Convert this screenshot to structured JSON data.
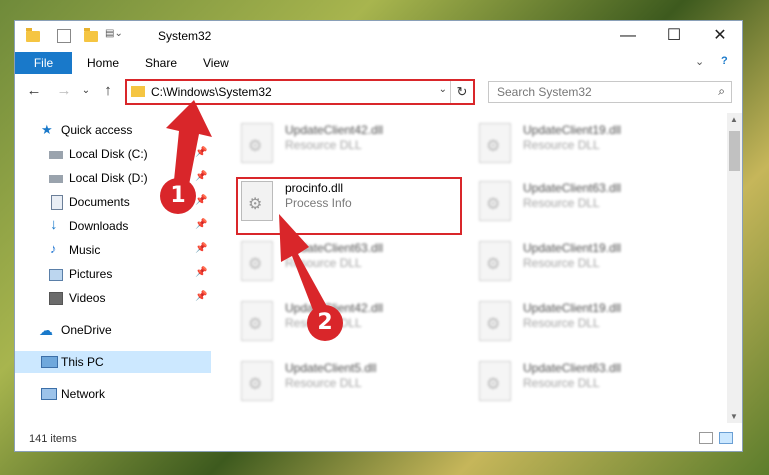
{
  "window": {
    "title": "System32",
    "minimize": "—",
    "maximize": "☐",
    "close": "✕"
  },
  "ribbon": {
    "tabs": [
      "File",
      "Home",
      "Share",
      "View"
    ],
    "expand": "⌄",
    "help": "?"
  },
  "address": {
    "path": "C:\\Windows\\System32",
    "dropdown": "⌄",
    "refresh": "↻"
  },
  "search": {
    "placeholder": "Search System32"
  },
  "nav_buttons": {
    "back": "←",
    "forward": "→",
    "recent": "⌄",
    "up": "↑"
  },
  "nav": {
    "items": [
      {
        "label": "Quick access",
        "icon": "star-icon",
        "pinned": false
      },
      {
        "label": "Local Disk (C:)",
        "icon": "drive-icon",
        "pinned": true
      },
      {
        "label": "Local Disk (D:)",
        "icon": "drive-icon",
        "pinned": true
      },
      {
        "label": "Documents",
        "icon": "documents-icon",
        "pinned": true
      },
      {
        "label": "Downloads",
        "icon": "download-icon",
        "pinned": true
      },
      {
        "label": "Music",
        "icon": "music-icon",
        "pinned": true
      },
      {
        "label": "Pictures",
        "icon": "pictures-icon",
        "pinned": true
      },
      {
        "label": "Videos",
        "icon": "videos-icon",
        "pinned": true
      },
      {
        "label": "OneDrive",
        "icon": "cloud-icon",
        "pinned": false
      },
      {
        "label": "This PC",
        "icon": "computer-icon",
        "pinned": false,
        "selected": true
      },
      {
        "label": "Network",
        "icon": "network-icon",
        "pinned": false
      }
    ]
  },
  "files": [
    {
      "name": "UpdateClient42.dll",
      "desc": "Resource DLL"
    },
    {
      "name": "UpdateClient19.dll",
      "desc": "Resource DLL"
    },
    {
      "name": "procinfo.dll",
      "desc": "Process Info",
      "highlight": true
    },
    {
      "name": "UpdateClient63.dll",
      "desc": "Resource DLL"
    },
    {
      "name": "UpdateClient63.dll",
      "desc": "Resource DLL"
    },
    {
      "name": "UpdateClient19.dll",
      "desc": "Resource DLL"
    },
    {
      "name": "UpdateClient42.dll",
      "desc": "Resource DLL"
    },
    {
      "name": "UpdateClient19.dll",
      "desc": "Resource DLL"
    },
    {
      "name": "UpdateClient5.dll",
      "desc": "Resource DLL"
    },
    {
      "name": "UpdateClient63.dll",
      "desc": "Resource DLL"
    }
  ],
  "status": {
    "item_count": "141 items"
  },
  "callouts": [
    "1",
    "2"
  ],
  "colors": {
    "accent": "#1979ca",
    "highlight": "#d9262a",
    "selection": "#cce8ff"
  }
}
